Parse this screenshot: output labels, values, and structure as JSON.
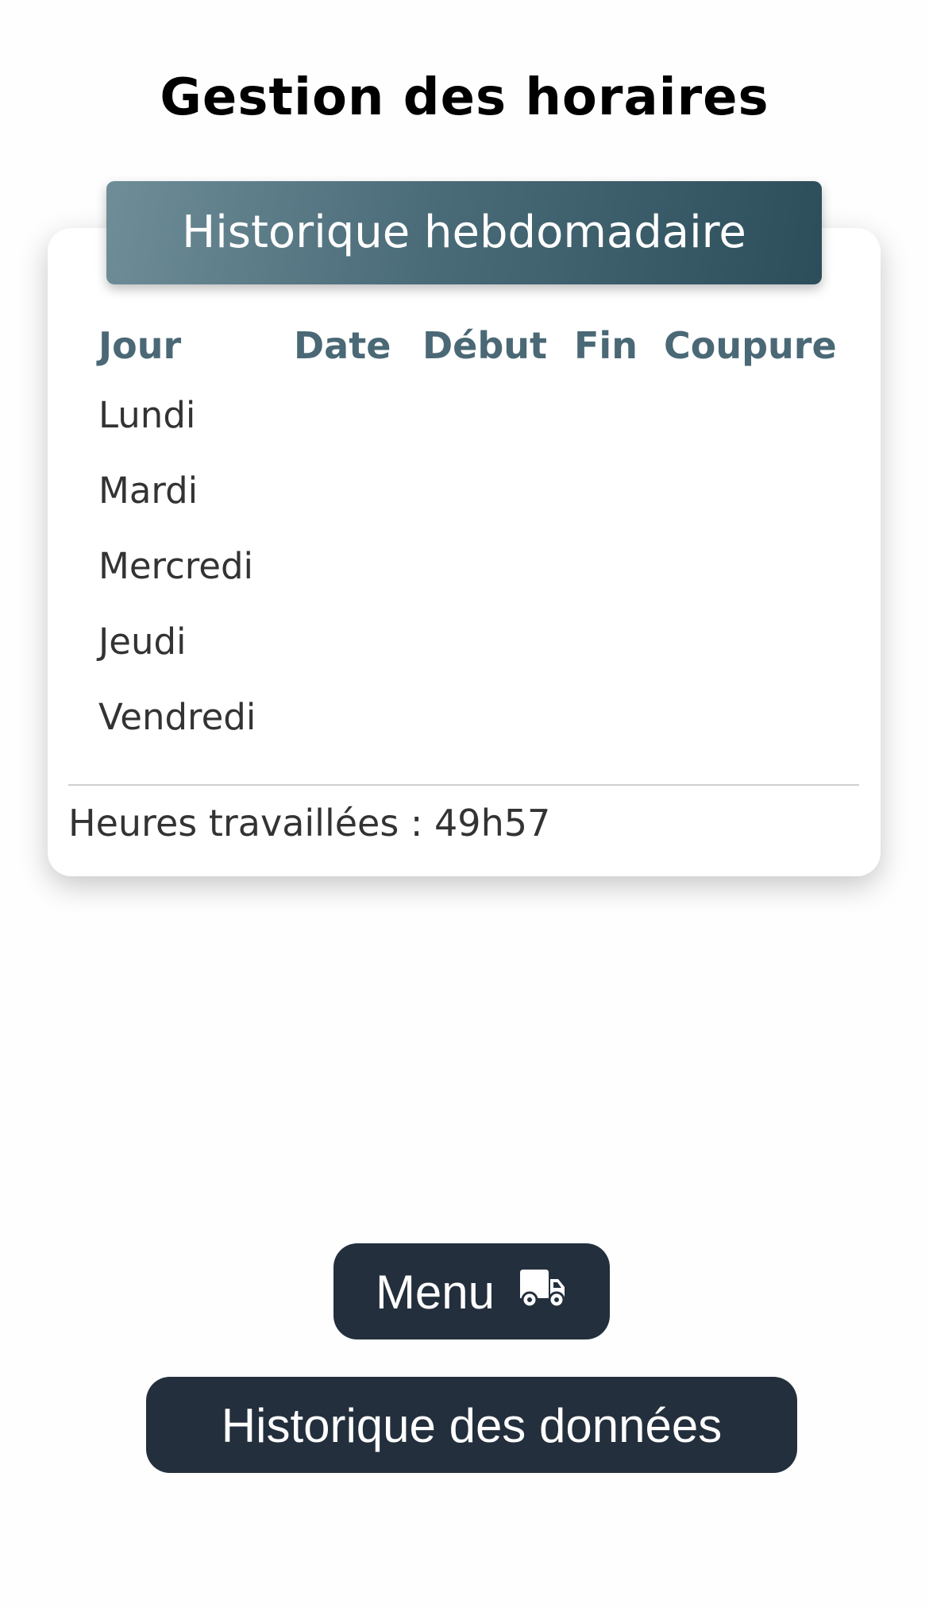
{
  "page": {
    "title": "Gestion des horaires"
  },
  "card": {
    "header": "Historique hebdomadaire",
    "columns": [
      "Jour",
      "Date",
      "Début",
      "Fin",
      "Coupure"
    ],
    "rows": [
      {
        "day": "Lundi",
        "date": "",
        "start": "",
        "end": "",
        "break": ""
      },
      {
        "day": "Mardi",
        "date": "",
        "start": "",
        "end": "",
        "break": ""
      },
      {
        "day": "Mercredi",
        "date": "",
        "start": "",
        "end": "",
        "break": ""
      },
      {
        "day": "Jeudi",
        "date": "",
        "start": "",
        "end": "",
        "break": ""
      },
      {
        "day": "Vendredi",
        "date": "",
        "start": "",
        "end": "",
        "break": ""
      }
    ],
    "total_hours": "Heures travaillées : 49h57"
  },
  "buttons": {
    "menu_label": "Menu",
    "menu_icon": "truck-icon",
    "history_label": "Historique des données"
  },
  "colors": {
    "header_gradient_start": "#6e8d98",
    "header_gradient_end": "#2c4e5b",
    "column_header": "#4a6875",
    "button_bg": "#232f3c"
  }
}
